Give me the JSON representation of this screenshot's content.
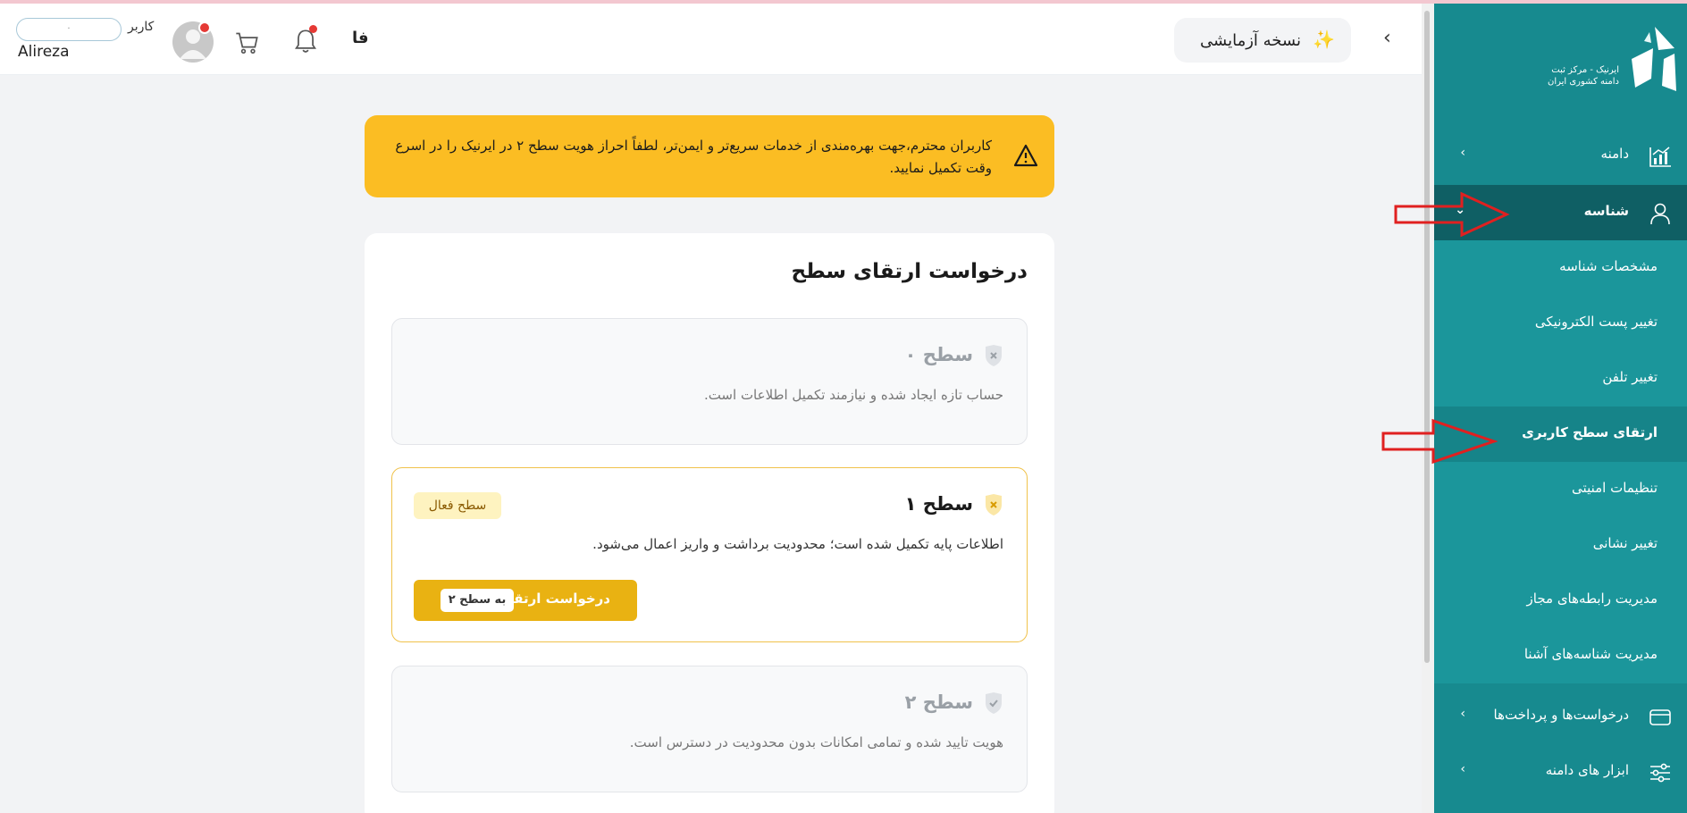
{
  "sidebar": {
    "logo_line1": "ایرنیک - مرکز ثبت",
    "logo_line2": "دامنه کشوری ایران",
    "items": [
      {
        "label": "دامنه",
        "icon": "chart-icon",
        "chevron": "›"
      },
      {
        "label": "شناسه",
        "icon": "user-icon",
        "chevron": "⌄"
      },
      {
        "label": "درخواست‌ها و پرداخت‌ها",
        "icon": "card-icon",
        "chevron": "›"
      },
      {
        "label": "ابزار های دامنه",
        "icon": "sliders-icon",
        "chevron": "›"
      }
    ],
    "subitems": [
      {
        "label": "مشخصات شناسه"
      },
      {
        "label": "تغییر پست الکترونیکی"
      },
      {
        "label": "تغییر تلفن"
      },
      {
        "label": "ارتقای سطح کاربری"
      },
      {
        "label": "تنظیمات امنیتی"
      },
      {
        "label": "تغییر نشانی"
      },
      {
        "label": "مدیریت رابطه‌های مجاز"
      },
      {
        "label": "مدیریت شناسه‌های آشنا"
      }
    ]
  },
  "topbar": {
    "back": "‹",
    "demo_star": "✨",
    "demo_label": "نسخه آزمایشی",
    "lang": "فا",
    "user_role": "کاربر",
    "user_input_value": "·",
    "user_name": "Alireza"
  },
  "alert": {
    "message": "کاربران محترم،جهت بهره‌مندی از خدمات سریع‌تر و ایمن‌تر، لطفاً احراز هویت سطح ۲ در ایرنیک را در اسرع وقت تکمیل نمایید."
  },
  "card": {
    "title": "درخواست ارتقای سطح",
    "levels": [
      {
        "name": "سطح ۰",
        "desc": "حساب تازه ایجاد شده و نیازمند تکمیل اطلاعات است.",
        "state": "inactive"
      },
      {
        "name": "سطح ۱",
        "desc": "اطلاعات پایه تکمیل شده است؛ محدودیت برداشت و واریز اعمال می‌شود.",
        "state": "active",
        "badge": "سطح فعال",
        "button_label": "درخواست ارتقا",
        "button_chip": "به سطح ۲"
      },
      {
        "name": "سطح ۲",
        "desc": "هویت تایید شده و تمامی امکانات بدون محدودیت در دسترس است.",
        "state": "inactive"
      }
    ]
  },
  "colors": {
    "sidebar": "#178a8f",
    "sidebar_active": "#0f5f64",
    "alert": "#fbbd23",
    "accent_button": "#e9b212",
    "annotation_arrow": "#e02020"
  }
}
